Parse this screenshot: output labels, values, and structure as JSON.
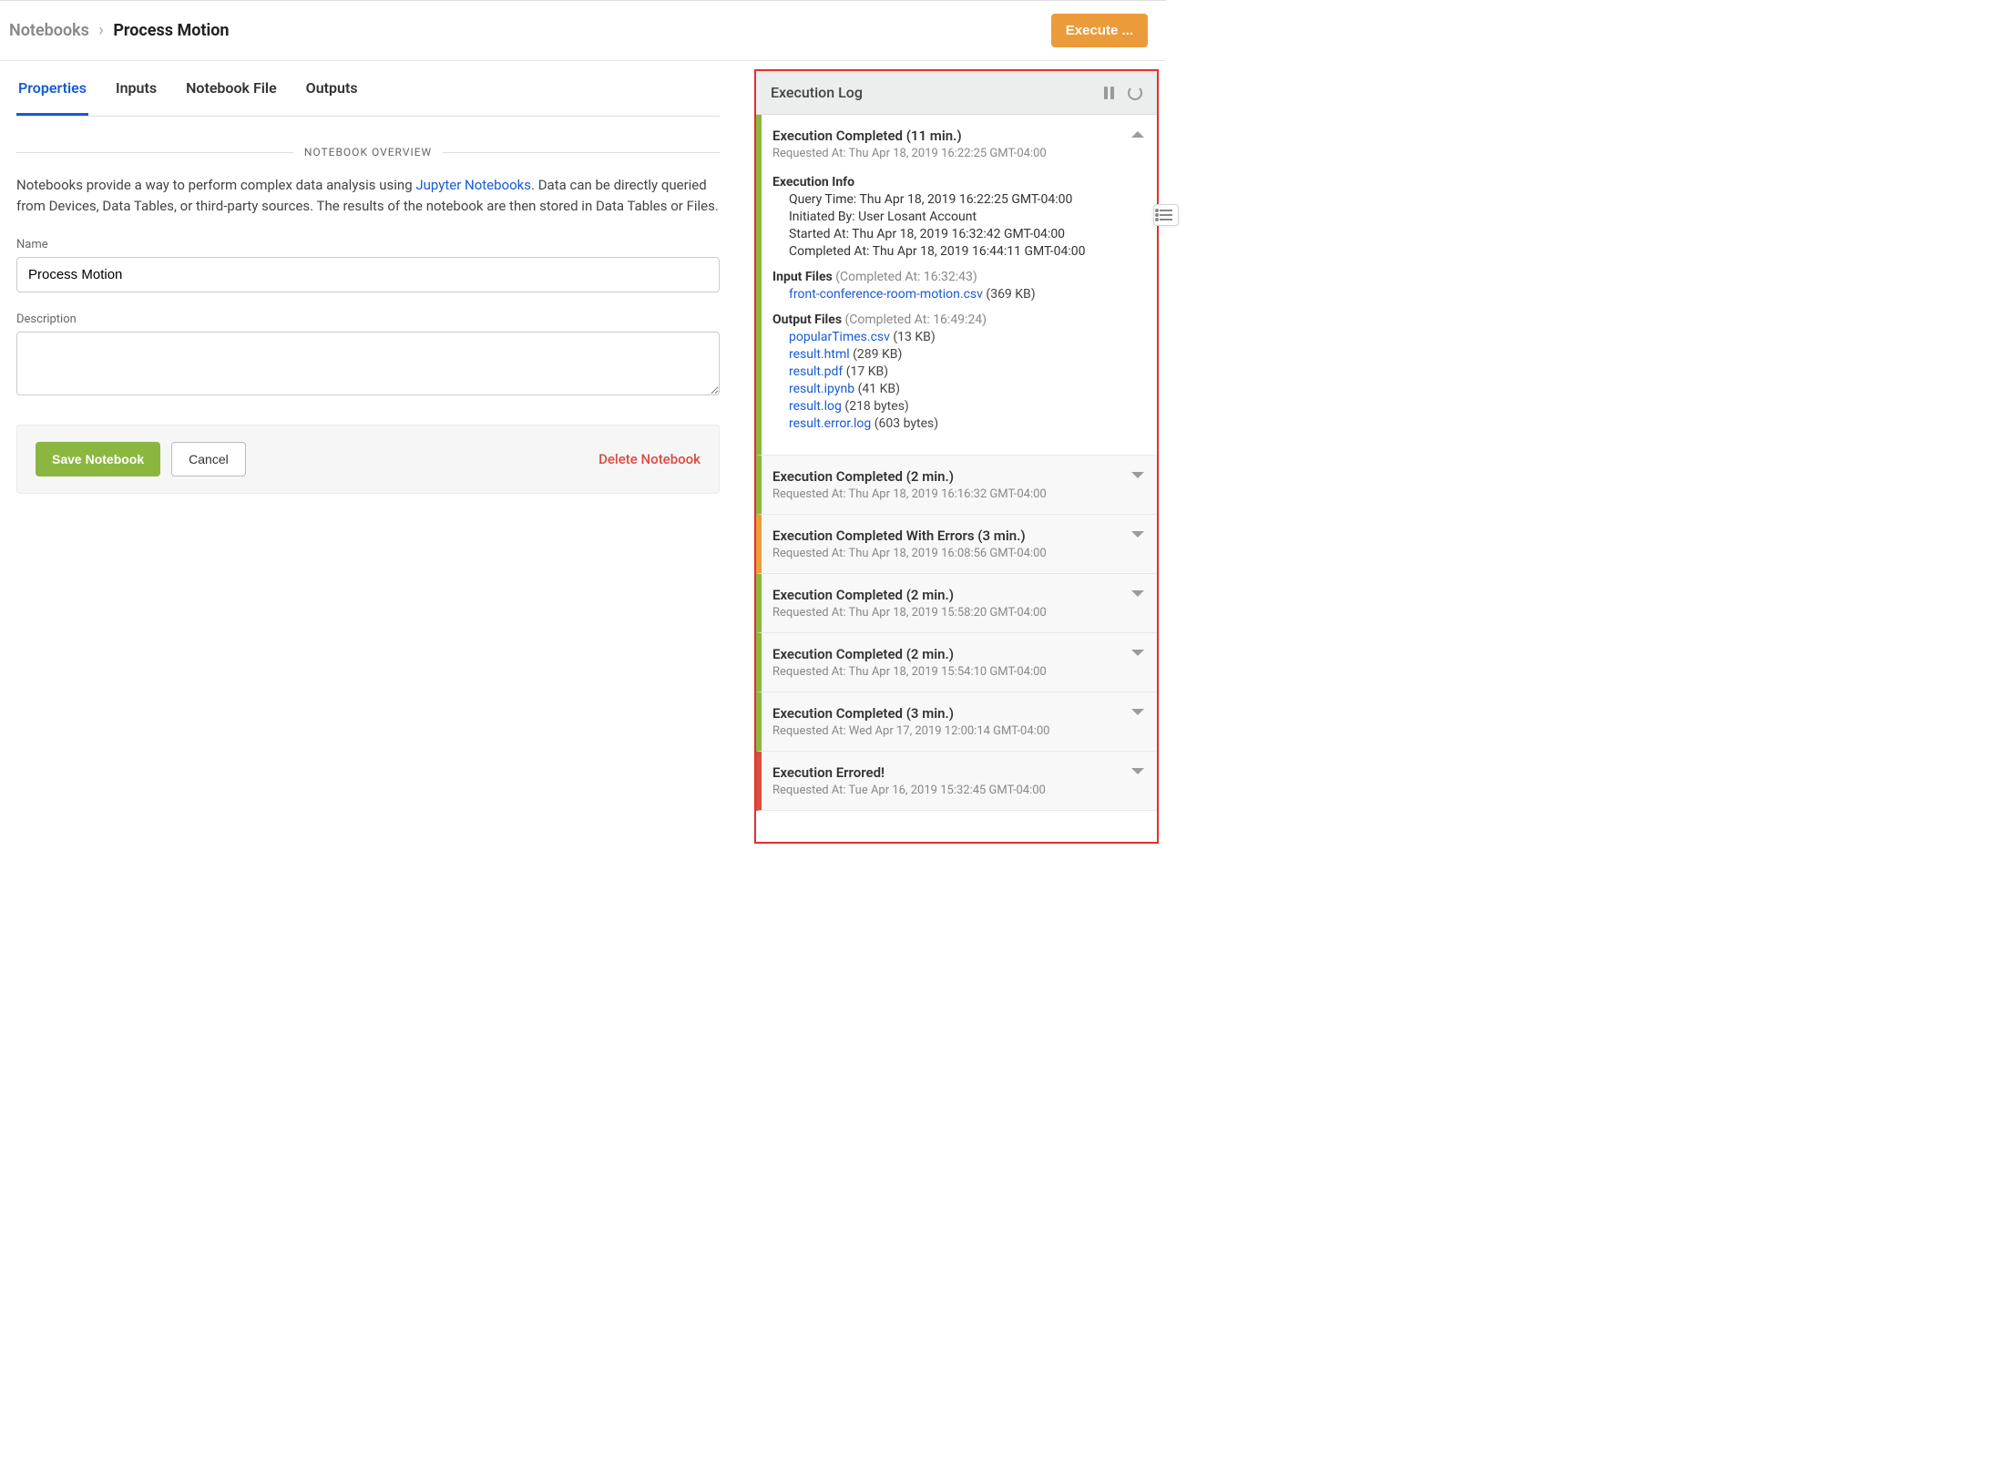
{
  "breadcrumb": {
    "root": "Notebooks",
    "current": "Process Motion"
  },
  "execute_label": "Execute ...",
  "tabs": [
    "Properties",
    "Inputs",
    "Notebook File",
    "Outputs"
  ],
  "section_title": "NOTEBOOK OVERVIEW",
  "overview": {
    "p1": "Notebooks provide a way to perform complex data analysis using ",
    "link": "Jupyter Notebooks",
    "p2": ". Data can be directly queried from Devices, Data Tables, or third-party sources. The results of the notebook are then stored in Data Tables or Files."
  },
  "form": {
    "name_label": "Name",
    "name_value": "Process Motion",
    "desc_label": "Description",
    "desc_value": ""
  },
  "actions": {
    "save": "Save Notebook",
    "cancel": "Cancel",
    "delete": "Delete Notebook"
  },
  "log": {
    "title": "Execution Log",
    "expanded": {
      "title": "Execution Completed (11 min.)",
      "requested": "Requested At: Thu Apr 18, 2019 16:22:25 GMT-04:00",
      "info_heading": "Execution Info",
      "info": [
        "Query Time: Thu Apr 18, 2019 16:22:25 GMT-04:00",
        "Initiated By: User Losant Account",
        "Started At: Thu Apr 18, 2019 16:32:42 GMT-04:00",
        "Completed At: Thu Apr 18, 2019 16:44:11 GMT-04:00"
      ],
      "input_heading": "Input Files",
      "input_meta": "(Completed At: 16:32:43)",
      "input_files": [
        {
          "name": "front-conference-room-motion.csv",
          "size": "(369 KB)"
        }
      ],
      "output_heading": "Output Files",
      "output_meta": "(Completed At: 16:49:24)",
      "output_files": [
        {
          "name": "popularTimes.csv",
          "size": "(13 KB)"
        },
        {
          "name": "result.html",
          "size": "(289 KB)"
        },
        {
          "name": "result.pdf",
          "size": "(17 KB)"
        },
        {
          "name": "result.ipynb",
          "size": "(41 KB)"
        },
        {
          "name": "result.log",
          "size": "(218 bytes)"
        },
        {
          "name": "result.error.log",
          "size": "(603 bytes)"
        }
      ]
    },
    "entries": [
      {
        "status": "success",
        "title": "Execution Completed (2 min.)",
        "sub": "Requested At: Thu Apr 18, 2019 16:16:32 GMT-04:00"
      },
      {
        "status": "warn",
        "title": "Execution Completed With Errors (3 min.)",
        "sub": "Requested At: Thu Apr 18, 2019 16:08:56 GMT-04:00"
      },
      {
        "status": "success",
        "title": "Execution Completed (2 min.)",
        "sub": "Requested At: Thu Apr 18, 2019 15:58:20 GMT-04:00"
      },
      {
        "status": "success",
        "title": "Execution Completed (2 min.)",
        "sub": "Requested At: Thu Apr 18, 2019 15:54:10 GMT-04:00"
      },
      {
        "status": "success",
        "title": "Execution Completed (3 min.)",
        "sub": "Requested At: Wed Apr 17, 2019 12:00:14 GMT-04:00"
      },
      {
        "status": "error",
        "title": "Execution Errored!",
        "sub": "Requested At: Tue Apr 16, 2019 15:32:45 GMT-04:00"
      }
    ]
  }
}
